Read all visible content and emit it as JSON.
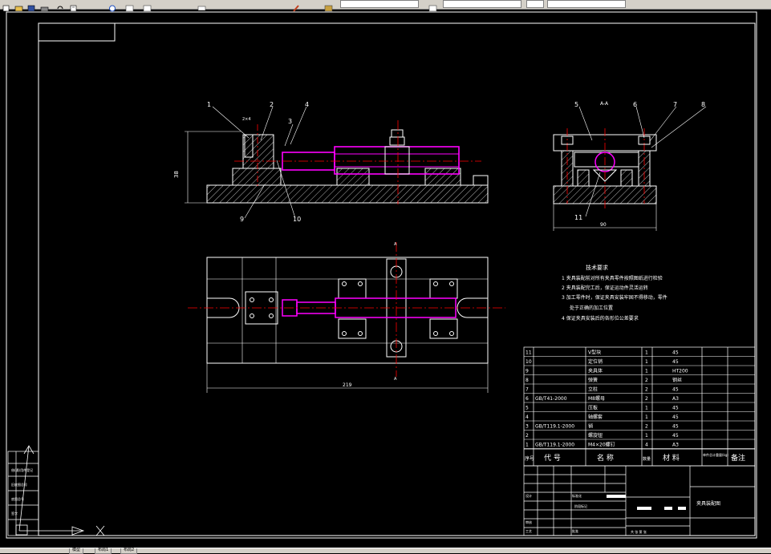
{
  "toolbar": {
    "buttons": [
      "new-icon",
      "open-icon",
      "save-icon",
      "print-icon",
      "undo-icon",
      "redo-icon",
      "pan-icon",
      "zoom-icon",
      "properties-icon",
      "layer-icon",
      "matchprop-icon"
    ],
    "colors": {
      "bg": "#d4d0c8",
      "canvas": "#000000",
      "line": "#ffffff",
      "part": "#ff00ff",
      "center": "#ff0000",
      "hatch": "#ffffff"
    }
  },
  "balloons": {
    "n1": "1",
    "n2": "2",
    "n3": "3",
    "n4": "4",
    "n5": "5",
    "n6": "6",
    "n7": "7",
    "n8": "8",
    "n9": "9",
    "n10": "10",
    "n11": "11"
  },
  "dims": {
    "front_height": "38",
    "section_width": "90",
    "plan_width": "219",
    "section_label": "A-A",
    "cut_a_top": "A",
    "cut_a_bottom": "A",
    "front_note": "2×4"
  },
  "tech": {
    "title": "技术要求",
    "line1": "1 夹具装配前对所有夹具零件按照图纸进行检验",
    "line2": "2 夹具装配完工后，保证运动件灵活运转",
    "line3": "3 加工零件时，保证夹具安装牢固不得移动，零件",
    "line4": "处于正确的加工位置",
    "line5": "4 保证夹具安装后的各形位公差要求"
  },
  "bom": {
    "rows": [
      {
        "no": "11",
        "code": "",
        "name": "V型块",
        "qty": "1",
        "mat": "45"
      },
      {
        "no": "10",
        "code": "",
        "name": "定位销",
        "qty": "1",
        "mat": "45"
      },
      {
        "no": "9",
        "code": "",
        "name": "夹具体",
        "qty": "1",
        "mat": "HT200"
      },
      {
        "no": "8",
        "code": "",
        "name": "弹簧",
        "qty": "2",
        "mat": "钢丝"
      },
      {
        "no": "7",
        "code": "",
        "name": "立柱",
        "qty": "2",
        "mat": "45"
      },
      {
        "no": "6",
        "code": "GB/T41-2000",
        "name": "M8螺母",
        "qty": "2",
        "mat": "A3"
      },
      {
        "no": "5",
        "code": "",
        "name": "压板",
        "qty": "1",
        "mat": "45"
      },
      {
        "no": "4",
        "code": "",
        "name": "轴螺套",
        "qty": "1",
        "mat": "45"
      },
      {
        "no": "3",
        "code": "GB/T119.1-2000",
        "name": "销",
        "qty": "2",
        "mat": "45"
      },
      {
        "no": "2",
        "code": "",
        "name": "螺旋钮",
        "qty": "1",
        "mat": "45"
      },
      {
        "no": "1",
        "code": "GB/T119.1-2000",
        "name": "M4×20螺钉",
        "qty": "4",
        "mat": "A3"
      }
    ],
    "header": {
      "no": "序号",
      "code": "代  号",
      "name": "名  称",
      "qty": "数量",
      "mat": "材  料",
      "weight": "单件总计重量(kg)",
      "remark": "备注"
    }
  },
  "titleblock": {
    "drawing_name": "夹具装配图",
    "design": "设计",
    "standard": "标准化",
    "review": "审核",
    "craft": "工艺",
    "approve": "批准",
    "sheet": "共  张  第  张",
    "stage": "阶段标记",
    "weight": "重量",
    "scale": "比例"
  },
  "sidebar": {
    "l1": "借(通)用件登记",
    "l2": "旧底图总号",
    "l3": "底图总号",
    "l4": "签字"
  },
  "ucs": {
    "x": "X",
    "y": "Y"
  },
  "statusbar": {
    "tab1": "模型",
    "tab2": "布局1",
    "tab3": "布局2"
  }
}
